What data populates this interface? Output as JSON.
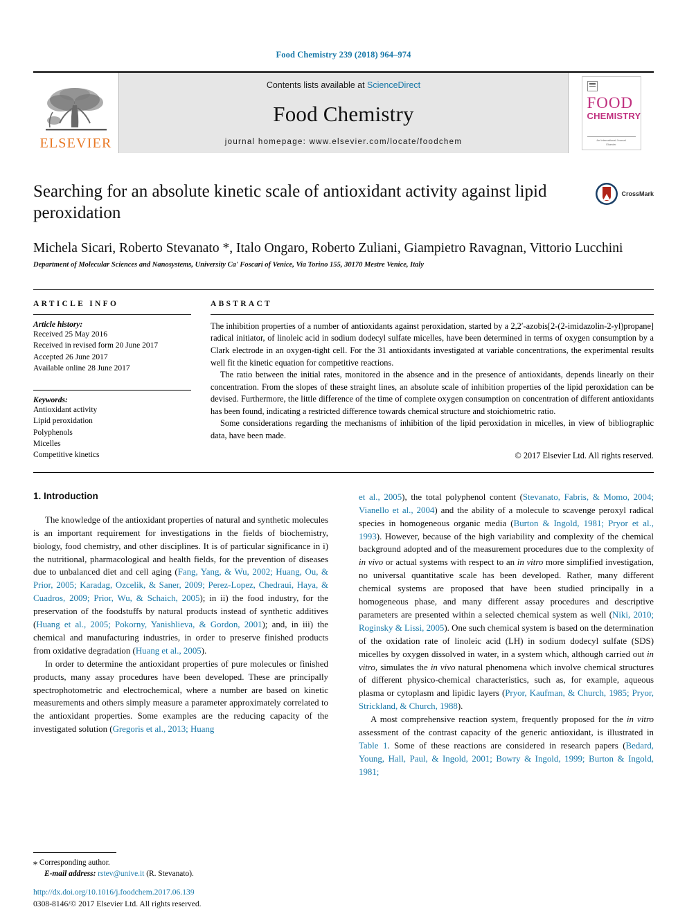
{
  "running_head": "Food Chemistry 239 (2018) 964–974",
  "masthead": {
    "publisher_name": "ELSEVIER",
    "contents_prefix": "Contents lists available at ",
    "contents_link": "ScienceDirect",
    "journal_name": "Food Chemistry",
    "homepage": "journal homepage: www.elsevier.com/locate/foodchem",
    "cover": {
      "line1": "FOOD",
      "line2": "CHEMISTRY",
      "footer": "An International Journal\nElsevier Science Direct"
    }
  },
  "title": "Searching for an absolute kinetic scale of antioxidant activity against lipid peroxidation",
  "crossmark_label": "CrossMark",
  "authors": "Michela Sicari, Roberto Stevanato *, Italo Ongaro, Roberto Zuliani, Giampietro Ravagnan, Vittorio Lucchini",
  "affiliation": "Department of Molecular Sciences and Nanosystems, University Ca' Foscari of Venice, Via Torino 155, 30170 Mestre Venice, Italy",
  "article_info": {
    "label": "ARTICLE INFO",
    "history_heading": "Article history:",
    "history": [
      "Received 25 May 2016",
      "Received in revised form 20 June 2017",
      "Accepted 26 June 2017",
      "Available online 28 June 2017"
    ],
    "keywords_heading": "Keywords:",
    "keywords": [
      "Antioxidant activity",
      "Lipid peroxidation",
      "Polyphenols",
      "Micelles",
      "Competitive kinetics"
    ]
  },
  "abstract": {
    "label": "ABSTRACT",
    "paragraphs": [
      "The inhibition properties of a number of antioxidants against peroxidation, started by a 2,2′-azobis[2-(2-imidazolin-2-yl)propane] radical initiator, of linoleic acid in sodium dodecyl sulfate micelles, have been determined in terms of oxygen consumption by a Clark electrode in an oxygen-tight cell. For the 31 antioxidants investigated at variable concentrations, the experimental results well fit the kinetic equation for competitive reactions.",
      "The ratio between the initial rates, monitored in the absence and in the presence of antioxidants, depends linearly on their concentration. From the slopes of these straight lines, an absolute scale of inhibition properties of the lipid peroxidation can be devised. Furthermore, the little difference of the time of complete oxygen consumption on concentration of different antioxidants has been found, indicating a restricted difference towards chemical structure and stoichiometric ratio.",
      "Some considerations regarding the mechanisms of inhibition of the lipid peroxidation in micelles, in view of bibliographic data, have been made."
    ],
    "copyright": "© 2017 Elsevier Ltd. All rights reserved."
  },
  "section": {
    "heading": "1. Introduction"
  },
  "left_column": {
    "p1_a": "The knowledge of the antioxidant properties of natural and synthetic molecules is an important requirement for investigations in the fields of biochemistry, biology, food chemistry, and other disciplines. It is of particular significance in i) the nutritional, pharmacological and health fields, for the prevention of diseases due to unbalanced diet and cell aging (",
    "p1_ref1": "Fang, Yang, & Wu, 2002; Huang, Ou, & Prior, 2005; Karadag, Ozcelik, & Saner, 2009; Perez-Lopez, Chedraui, Haya, & Cuadros, 2009; Prior, Wu, & Schaich, 2005",
    "p1_b": "); in ii) the food industry, for the preservation of the foodstuffs by natural products instead of synthetic additives (",
    "p1_ref2": "Huang et al., 2005; Pokorny, Yanishlieva, & Gordon, 2001",
    "p1_c": "); and, in iii) the chemical and manufacturing industries, in order to preserve finished products from oxidative degradation (",
    "p1_ref3": "Huang et al., 2005",
    "p1_d": ").",
    "p2_a": "In order to determine the antioxidant properties of pure molecules or finished products, many assay procedures have been developed. These are principally spectrophotometric and electrochemical, where a number are based on kinetic measurements and others simply measure a parameter approximately correlated to the antioxidant properties. Some examples are the reducing capacity of the investigated solution (",
    "p2_ref1": "Gregoris et al., 2013; Huang"
  },
  "right_column": {
    "p2_ref_cont": "et al., 2005",
    "p2_b": "), the total polyphenol content (",
    "p2_ref2": "Stevanato, Fabris, & Momo, 2004; Vianello et al., 2004",
    "p2_c": ") and the ability of a molecule to scavenge peroxyl radical species in homogeneous organic media (",
    "p2_ref3": "Burton & Ingold, 1981; Pryor et al., 1993",
    "p2_d": "). However, because of the high variability and complexity of the chemical background adopted and of the measurement procedures due to the complexity of ",
    "p2_it1": "in vivo",
    "p2_e": " or actual systems with respect to an ",
    "p2_it2": "in vitro",
    "p2_f": " more simplified investigation, no universal quantitative scale has been developed. Rather, many different chemical systems are proposed that have been studied principally in a homogeneous phase, and many different assay procedures and descriptive parameters are presented within a selected chemical system as well (",
    "p2_ref4": "Niki, 2010; Roginsky & Lissi, 2005",
    "p2_g": "). One such chemical system is based on the determination of the oxidation rate of linoleic acid (LH) in sodium dodecyl sulfate (SDS) micelles by oxygen dissolved in water, in a system which, although carried out ",
    "p2_it3": "in vitro",
    "p2_h": ", simulates the ",
    "p2_it4": "in vivo",
    "p2_i": " natural phenomena which involve chemical structures of different physico-chemical characteristics, such as, for example, aqueous plasma or cytoplasm and lipidic layers (",
    "p2_ref5": "Pryor, Kaufman, & Church, 1985; Pryor, Strickland, & Church, 1988",
    "p2_j": ").",
    "p3_a": "A most comprehensive reaction system, frequently proposed for the ",
    "p3_it1": "in vitro",
    "p3_b": " assessment of the contrast capacity of the generic antioxidant, is illustrated in ",
    "p3_link": "Table 1",
    "p3_c": ". Some of these reactions are considered in research papers (",
    "p3_ref1": "Bedard, Young, Hall, Paul, & Ingold, 2001; Bowry & Ingold, 1999; Burton & Ingold, 1981;"
  },
  "footnote": {
    "star": "⁎",
    "corresponding": " Corresponding author.",
    "email_label": "E-mail address:",
    "email": "rstev@unive.it",
    "email_suffix": " (R. Stevanato)."
  },
  "footer": {
    "doi": "http://dx.doi.org/10.1016/j.foodchem.2017.06.139",
    "issn": "0308-8146/© 2017 Elsevier Ltd. All rights reserved."
  },
  "colors": {
    "link": "#1878a8",
    "elsevier_orange": "#e87722",
    "cover_magenta": "#c0307f",
    "masthead_grey": "#e6e6e6"
  }
}
